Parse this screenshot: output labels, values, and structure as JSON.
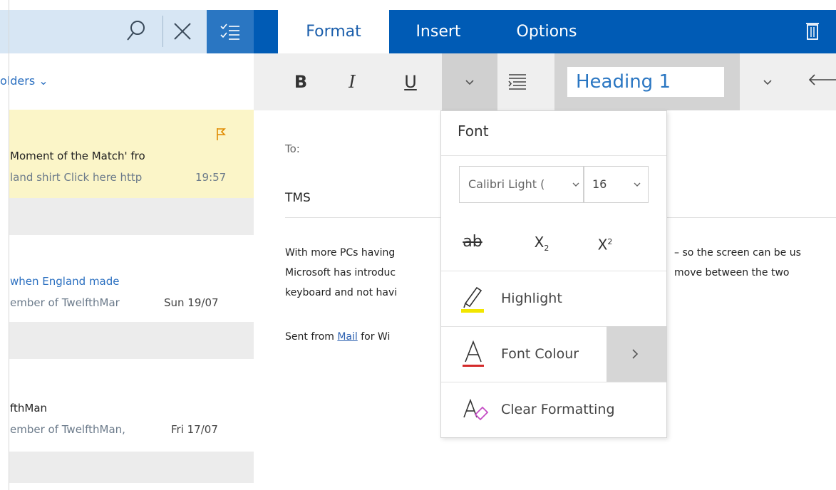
{
  "left_pane": {
    "folders_label": "olders ⌄",
    "messages": [
      {
        "line1": "Moment of the Match' fro",
        "line2": "land shirt Click here http",
        "time": "19:57",
        "flagged": true
      },
      {
        "line1": "when England made",
        "line2": "ember of TwelfthMar",
        "time": "Sun 19/07",
        "flagged": false
      },
      {
        "line1": "fthMan",
        "line2": "ember of TwelfthMan,",
        "time": "Fri 17/07",
        "flagged": false
      }
    ]
  },
  "ribbon": {
    "tabs": {
      "format": "Format",
      "insert": "Insert",
      "options": "Options"
    },
    "bold": "B",
    "italic": "I",
    "underline": "U",
    "style_value": "Heading 1"
  },
  "compose": {
    "to_label": "To:",
    "subject": "TMS",
    "body_lines": [
      "With more PCs having",
      "Microsoft has introduc",
      "keyboard and not havi"
    ],
    "body_right_lines": [
      "– so the screen can be us",
      "move between the two"
    ],
    "signature_prefix": "Sent from ",
    "signature_link": "Mail",
    "signature_suffix": " for Wi"
  },
  "font_panel": {
    "title": "Font",
    "font_name": "Calibri Light (",
    "font_size": "16",
    "strike_label": "ab",
    "subscript": "X",
    "subscript_mark": "2",
    "superscript": "X",
    "superscript_mark": "2",
    "highlight": "Highlight",
    "font_colour": "Font Colour",
    "clear_formatting": "Clear Formatting",
    "highlight_color": "#f2e600",
    "font_colour_color": "#d42a2a",
    "clear_color": "#c44cc4"
  },
  "colors": {
    "ribbon_blue": "#005bb5",
    "accent_blue": "#2a76c2",
    "flag_orange": "#e08a00",
    "selected_message_bg": "#fbf5c8"
  }
}
